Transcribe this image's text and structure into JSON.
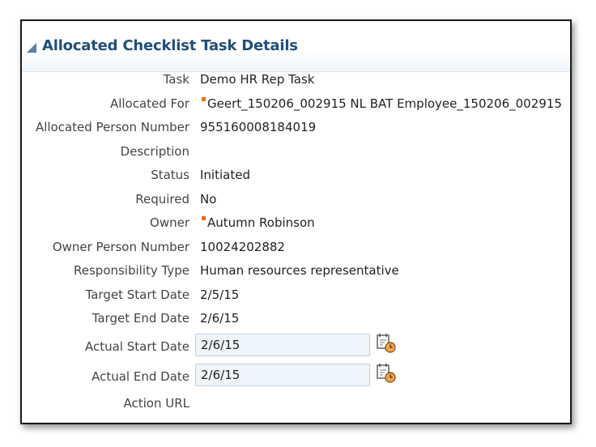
{
  "panel": {
    "title": "Allocated Checklist Task Details"
  },
  "fields": {
    "task": {
      "label": "Task",
      "value": "Demo HR Rep Task"
    },
    "allocated_for": {
      "label": "Allocated For",
      "value": "Geert_150206_002915 NL BAT Employee_150206_002915"
    },
    "allocated_person_number": {
      "label": "Allocated Person Number",
      "value": "955160008184019"
    },
    "description": {
      "label": "Description",
      "value": ""
    },
    "status": {
      "label": "Status",
      "value": "Initiated"
    },
    "required": {
      "label": "Required",
      "value": "No"
    },
    "owner": {
      "label": "Owner",
      "value": "Autumn Robinson"
    },
    "owner_person_number": {
      "label": "Owner Person Number",
      "value": "10024202882"
    },
    "responsibility_type": {
      "label": "Responsibility Type",
      "value": "Human resources representative"
    },
    "target_start_date": {
      "label": "Target Start Date",
      "value": "2/5/15"
    },
    "target_end_date": {
      "label": "Target End Date",
      "value": "2/6/15"
    },
    "actual_start_date": {
      "label": "Actual Start Date",
      "value": "2/6/15"
    },
    "actual_end_date": {
      "label": "Actual End Date",
      "value": "2/6/15"
    },
    "action_url": {
      "label": "Action URL",
      "value": ""
    }
  },
  "icons": {
    "collapse": "collapse-triangle-icon",
    "calendar": "calendar-clock-icon",
    "flag": "orange-marker-icon"
  },
  "colors": {
    "title": "#1f4f7a",
    "flag": "#f26b0f",
    "input_bg": "#eef5fb"
  }
}
